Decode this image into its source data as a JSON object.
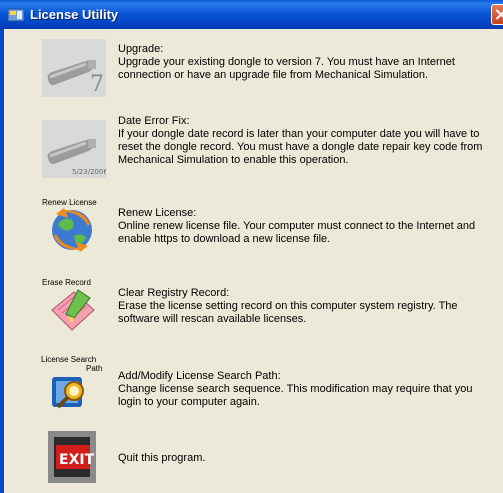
{
  "window": {
    "title": "License Utility"
  },
  "items": [
    {
      "id": "upgrade",
      "title": "Upgrade:",
      "desc": "Upgrade your existing dongle to version 7. You must have an Internet connection or have an upgrade file from Mechanical Simulation.",
      "icon_label": "",
      "icon": "usb-dongle-7-icon"
    },
    {
      "id": "date-error-fix",
      "title": "Date Error Fix:",
      "desc": "If your dongle date record is later than your computer date you will have to reset the dongle record. You must have a dongle date repair key code from Mechanical Simulation to enable this operation.",
      "icon_label": "",
      "icon_date": "5/23/2006",
      "icon": "usb-dongle-date-icon"
    },
    {
      "id": "renew-license",
      "title": "Renew License:",
      "desc": "Online renew license file. Your computer must connect to the Internet and enable https to download a new license file.",
      "icon_label": "Renew License",
      "icon": "globe-renew-icon"
    },
    {
      "id": "clear-registry",
      "title": "Clear Registry Record:",
      "desc": "Erase the license setting record on this computer system registry. The software will rescan available licenses.",
      "icon_label": "Erase Record",
      "icon": "erase-record-icon"
    },
    {
      "id": "license-search-path",
      "title": "Add/Modify License Search Path:",
      "desc": "Change license search sequence. This modification may require that you login to your computer again.",
      "icon_label": "License Search Path",
      "icon_label_line1": "License Search",
      "icon_label_line2": "Path",
      "icon": "search-path-icon"
    },
    {
      "id": "quit",
      "title": "",
      "desc": "Quit this program.",
      "icon_label": "",
      "icon_text": "EXIT",
      "icon": "exit-sign-icon"
    }
  ],
  "colors": {
    "titlebar": "#0A57D6",
    "panel": "#ECE9D8",
    "close": "#C8401D"
  }
}
